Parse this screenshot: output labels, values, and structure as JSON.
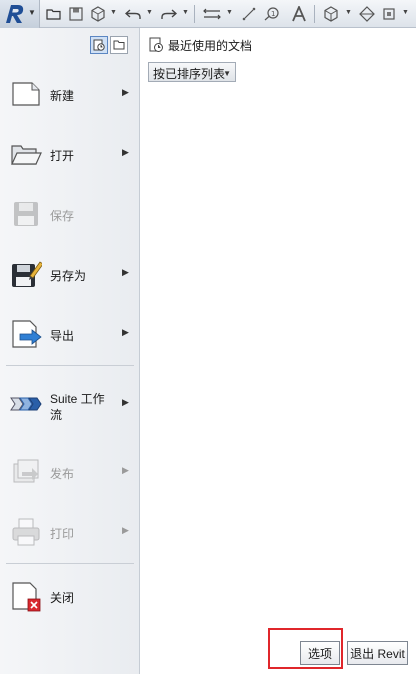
{
  "quick_access": {
    "icons": [
      "revit-app-icon",
      "open-icon",
      "save-icon",
      "sync-icon",
      "undo-icon",
      "redo-icon",
      "measure-icon",
      "dimension-icon",
      "tag-icon",
      "text-icon",
      "3d-view-icon",
      "section-icon"
    ]
  },
  "menu": {
    "items": [
      {
        "label": "新建",
        "has_submenu": true,
        "enabled": true,
        "icon": "new-doc-icon"
      },
      {
        "label": "打开",
        "has_submenu": true,
        "enabled": true,
        "icon": "open-folder-icon"
      },
      {
        "label": "保存",
        "has_submenu": false,
        "enabled": false,
        "icon": "save-icon"
      },
      {
        "label": "另存为",
        "has_submenu": true,
        "enabled": true,
        "icon": "save-as-icon"
      },
      {
        "label": "导出",
        "has_submenu": true,
        "enabled": true,
        "icon": "export-icon"
      },
      {
        "label": "Suite 工作流",
        "has_submenu": true,
        "enabled": true,
        "icon": "suite-workflow-icon"
      },
      {
        "label": "发布",
        "has_submenu": true,
        "enabled": false,
        "icon": "publish-icon"
      },
      {
        "label": "打印",
        "has_submenu": true,
        "enabled": false,
        "icon": "print-icon"
      },
      {
        "label": "关闭",
        "has_submenu": false,
        "enabled": true,
        "icon": "close-doc-icon"
      }
    ]
  },
  "recent": {
    "title": "最近使用的文档",
    "sort_label": "按已排序列表"
  },
  "footer": {
    "options_label": "选项",
    "exit_label": "退出 Revit"
  },
  "colors": {
    "highlight": "#e0262b",
    "accent_blue": "#2a5fa8"
  }
}
